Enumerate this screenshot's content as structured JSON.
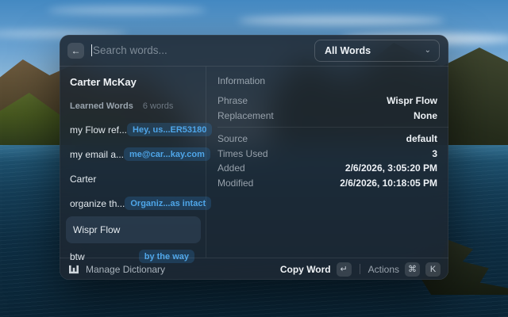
{
  "search": {
    "placeholder": "Search words..."
  },
  "filter": {
    "value": "All Words"
  },
  "sidebar": {
    "title": "Carter McKay",
    "section_label": "Learned Words",
    "section_count": "6 words",
    "items": [
      {
        "term": "my Flow ref...",
        "badge": "Hey, us...ER53180"
      },
      {
        "term": "my email a...",
        "badge": "me@car...kay.com"
      },
      {
        "term": "Carter",
        "badge": ""
      },
      {
        "term": "organize th...",
        "badge": "Organiz...as intact"
      },
      {
        "term": "Wispr Flow",
        "badge": ""
      },
      {
        "term": "btw",
        "badge": "by the way"
      }
    ]
  },
  "details": {
    "section_title": "Information",
    "rows_top": [
      {
        "label": "Phrase",
        "value": "Wispr Flow"
      },
      {
        "label": "Replacement",
        "value": "None"
      }
    ],
    "rows_bottom": [
      {
        "label": "Source",
        "value": "default"
      },
      {
        "label": "Times Used",
        "value": "3"
      },
      {
        "label": "Added",
        "value": "2/6/2026, 3:05:20 PM"
      },
      {
        "label": "Modified",
        "value": "2/6/2026, 10:18:05 PM"
      }
    ]
  },
  "footer": {
    "manage_label": "Manage Dictionary",
    "copy_label": "Copy Word",
    "copy_key": "↵",
    "actions_label": "Actions",
    "cmd_key": "⌘",
    "k_key": "K"
  },
  "icons": {
    "back": "←",
    "chevron_down": "⌄"
  },
  "colors": {
    "badge_text": "#4fa6e9",
    "badge_bg": "rgba(48,118,180,0.28)",
    "window_bg": "rgba(30,39,49,0.88)"
  }
}
